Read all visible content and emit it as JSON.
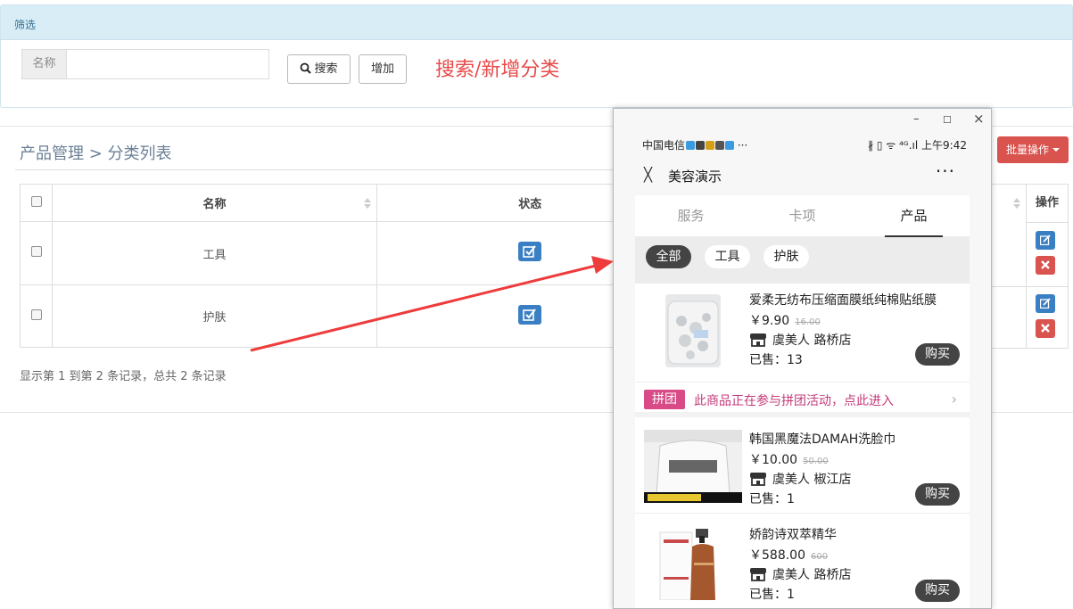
{
  "filter": {
    "heading": "筛选",
    "name_label": "名称",
    "name_value": "",
    "search_label": "搜索",
    "add_label": "增加",
    "annotation": "搜索/新增分类"
  },
  "breadcrumb": "产品管理 > 分类列表",
  "batch_label": "批量操作",
  "table": {
    "headers": [
      "名称",
      "状态"
    ],
    "action_header": "操作",
    "rows": [
      {
        "name": "工具",
        "status": true
      },
      {
        "name": "护肤",
        "status": true
      }
    ],
    "pager": "显示第 1 到第 2 条记录，总共 2 条记录"
  },
  "phone": {
    "window_controls": {
      "minimize": "–",
      "maximize": "☐",
      "close": "×"
    },
    "status_bar": {
      "carrier": "中国电信",
      "overflow": "···",
      "indicators": "∦ ▯ ᯤ ⁴ᴳ.ıl",
      "time": "上午9:42"
    },
    "title": "美容演示",
    "tabs": [
      "服务",
      "卡项",
      "产品"
    ],
    "active_tab": 2,
    "chips": [
      "全部",
      "工具",
      "护肤"
    ],
    "active_chip": 0,
    "buy_label": "购买",
    "products": [
      {
        "name": "爱柔无纺布压缩面膜纸纯棉贴纸膜",
        "price": "￥9.90",
        "orig": "16.00",
        "shop": "虞美人 路桥店",
        "sold": "已售：13"
      },
      {
        "name": "韩国黑魔法DAMAH洗脸巾",
        "price": "￥10.00",
        "orig": "50.00",
        "shop": "虞美人 椒江店",
        "sold": "已售：1"
      },
      {
        "name": "娇韵诗双萃精华",
        "price": "￥588.00",
        "orig": "600",
        "shop": "虞美人 路桥店",
        "sold": "已售：1"
      }
    ],
    "group": {
      "badge": "拼团",
      "text": "此商品正在参与拼团活动，点此进入",
      "chevron": "›"
    },
    "close_glyph": "╳",
    "more_glyph": "···"
  },
  "colors": {
    "accent": "#3a7fc3",
    "danger": "#d9534f",
    "annotation": "#e84a4a",
    "group": "#d94b86"
  }
}
